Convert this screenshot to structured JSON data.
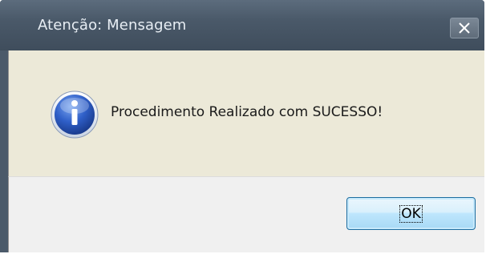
{
  "window": {
    "title": "Atenção: Mensagem",
    "close_icon": "close-icon"
  },
  "dialog": {
    "icon": "info-icon",
    "message": "Procedimento Realizado com SUCESSO!"
  },
  "buttons": {
    "ok_label": "OK"
  },
  "colors": {
    "titlebar": "#4a5969",
    "content_background": "#ece9d8",
    "footer_background": "#f0f0f0",
    "button_border": "#1d6da0"
  }
}
